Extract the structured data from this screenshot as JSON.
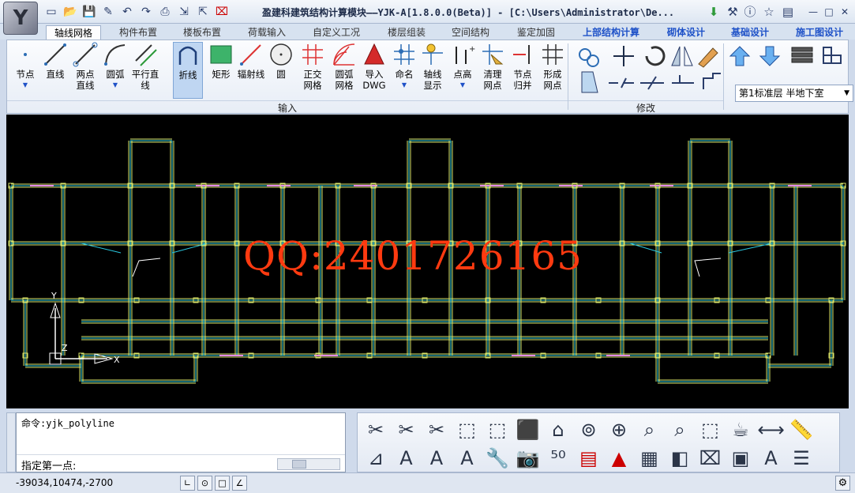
{
  "window": {
    "title": "盈建科建筑结构计算模块——YJK-A[1.8.0.0(Beta)] - [C:\\Users\\Administrator\\De...",
    "logo_letter": "Y",
    "controls": {
      "minimize": "—",
      "maximize": "□",
      "close": "✕"
    }
  },
  "ribbon_tabs": [
    {
      "label": "轴线网格",
      "active": true
    },
    {
      "label": "构件布置"
    },
    {
      "label": "楼板布置"
    },
    {
      "label": "荷载输入"
    },
    {
      "label": "自定义工况"
    },
    {
      "label": "楼层组装"
    },
    {
      "label": "空间结构"
    },
    {
      "label": "鉴定加固"
    },
    {
      "label": "上部结构计算",
      "highlight": true
    },
    {
      "label": "砌体设计",
      "highlight": true
    },
    {
      "label": "基础设计",
      "highlight": true
    },
    {
      "label": "施工图设计",
      "highlight": true
    }
  ],
  "ribbon_buttons": [
    {
      "label": "节点",
      "icon": "node-icon",
      "dropdown": true
    },
    {
      "label": "直线",
      "icon": "line-icon"
    },
    {
      "label": "两点\n直线",
      "icon": "two-point-line-icon"
    },
    {
      "label": "圆弧",
      "icon": "arc-icon",
      "dropdown": true
    },
    {
      "label": "平行直线",
      "icon": "parallel-line-icon"
    },
    {
      "label": "折线",
      "icon": "polyline-icon",
      "selected": true
    },
    {
      "label": "矩形",
      "icon": "rectangle-icon"
    },
    {
      "label": "辐射线",
      "icon": "radial-line-icon"
    },
    {
      "label": "圆",
      "icon": "circle-icon"
    },
    {
      "label": "正交\n网格",
      "icon": "orthogonal-grid-icon"
    },
    {
      "label": "圆弧\n网格",
      "icon": "arc-grid-icon"
    },
    {
      "label": "导入\nDWG",
      "icon": "import-dwg-icon"
    },
    {
      "label": "命名",
      "icon": "naming-icon",
      "dropdown": true
    },
    {
      "label": "轴线\n显示",
      "icon": "axis-display-icon"
    },
    {
      "label": "点高",
      "icon": "point-height-icon",
      "dropdown": true
    },
    {
      "label": "清理\n网点",
      "icon": "clean-grid-icon"
    },
    {
      "label": "节点\n归并",
      "icon": "merge-nodes-icon"
    },
    {
      "label": "形成\n网点",
      "icon": "form-grid-icon"
    }
  ],
  "ribbon_groups": {
    "input": "输入",
    "modify": "修改"
  },
  "floor_selector": {
    "value": "第1标准层 半地下室"
  },
  "watermark": "QQ:2401726165",
  "ucs": {
    "y": "Y",
    "z": "Z",
    "x": "X"
  },
  "command": {
    "history": "命令:yjk_polyline",
    "prompt": "指定第一点:"
  },
  "status": {
    "coordinates": "-39034,10474,-2700",
    "snap_buttons": [
      "∟",
      "⊙",
      "□",
      "∠"
    ]
  },
  "colors": {
    "canvas": "#000000",
    "grid_line": "#d8e46a",
    "axis_cyan": "#29c8e0",
    "watermark": "#ff3a10",
    "tab_highlight": "#1f52c8"
  }
}
